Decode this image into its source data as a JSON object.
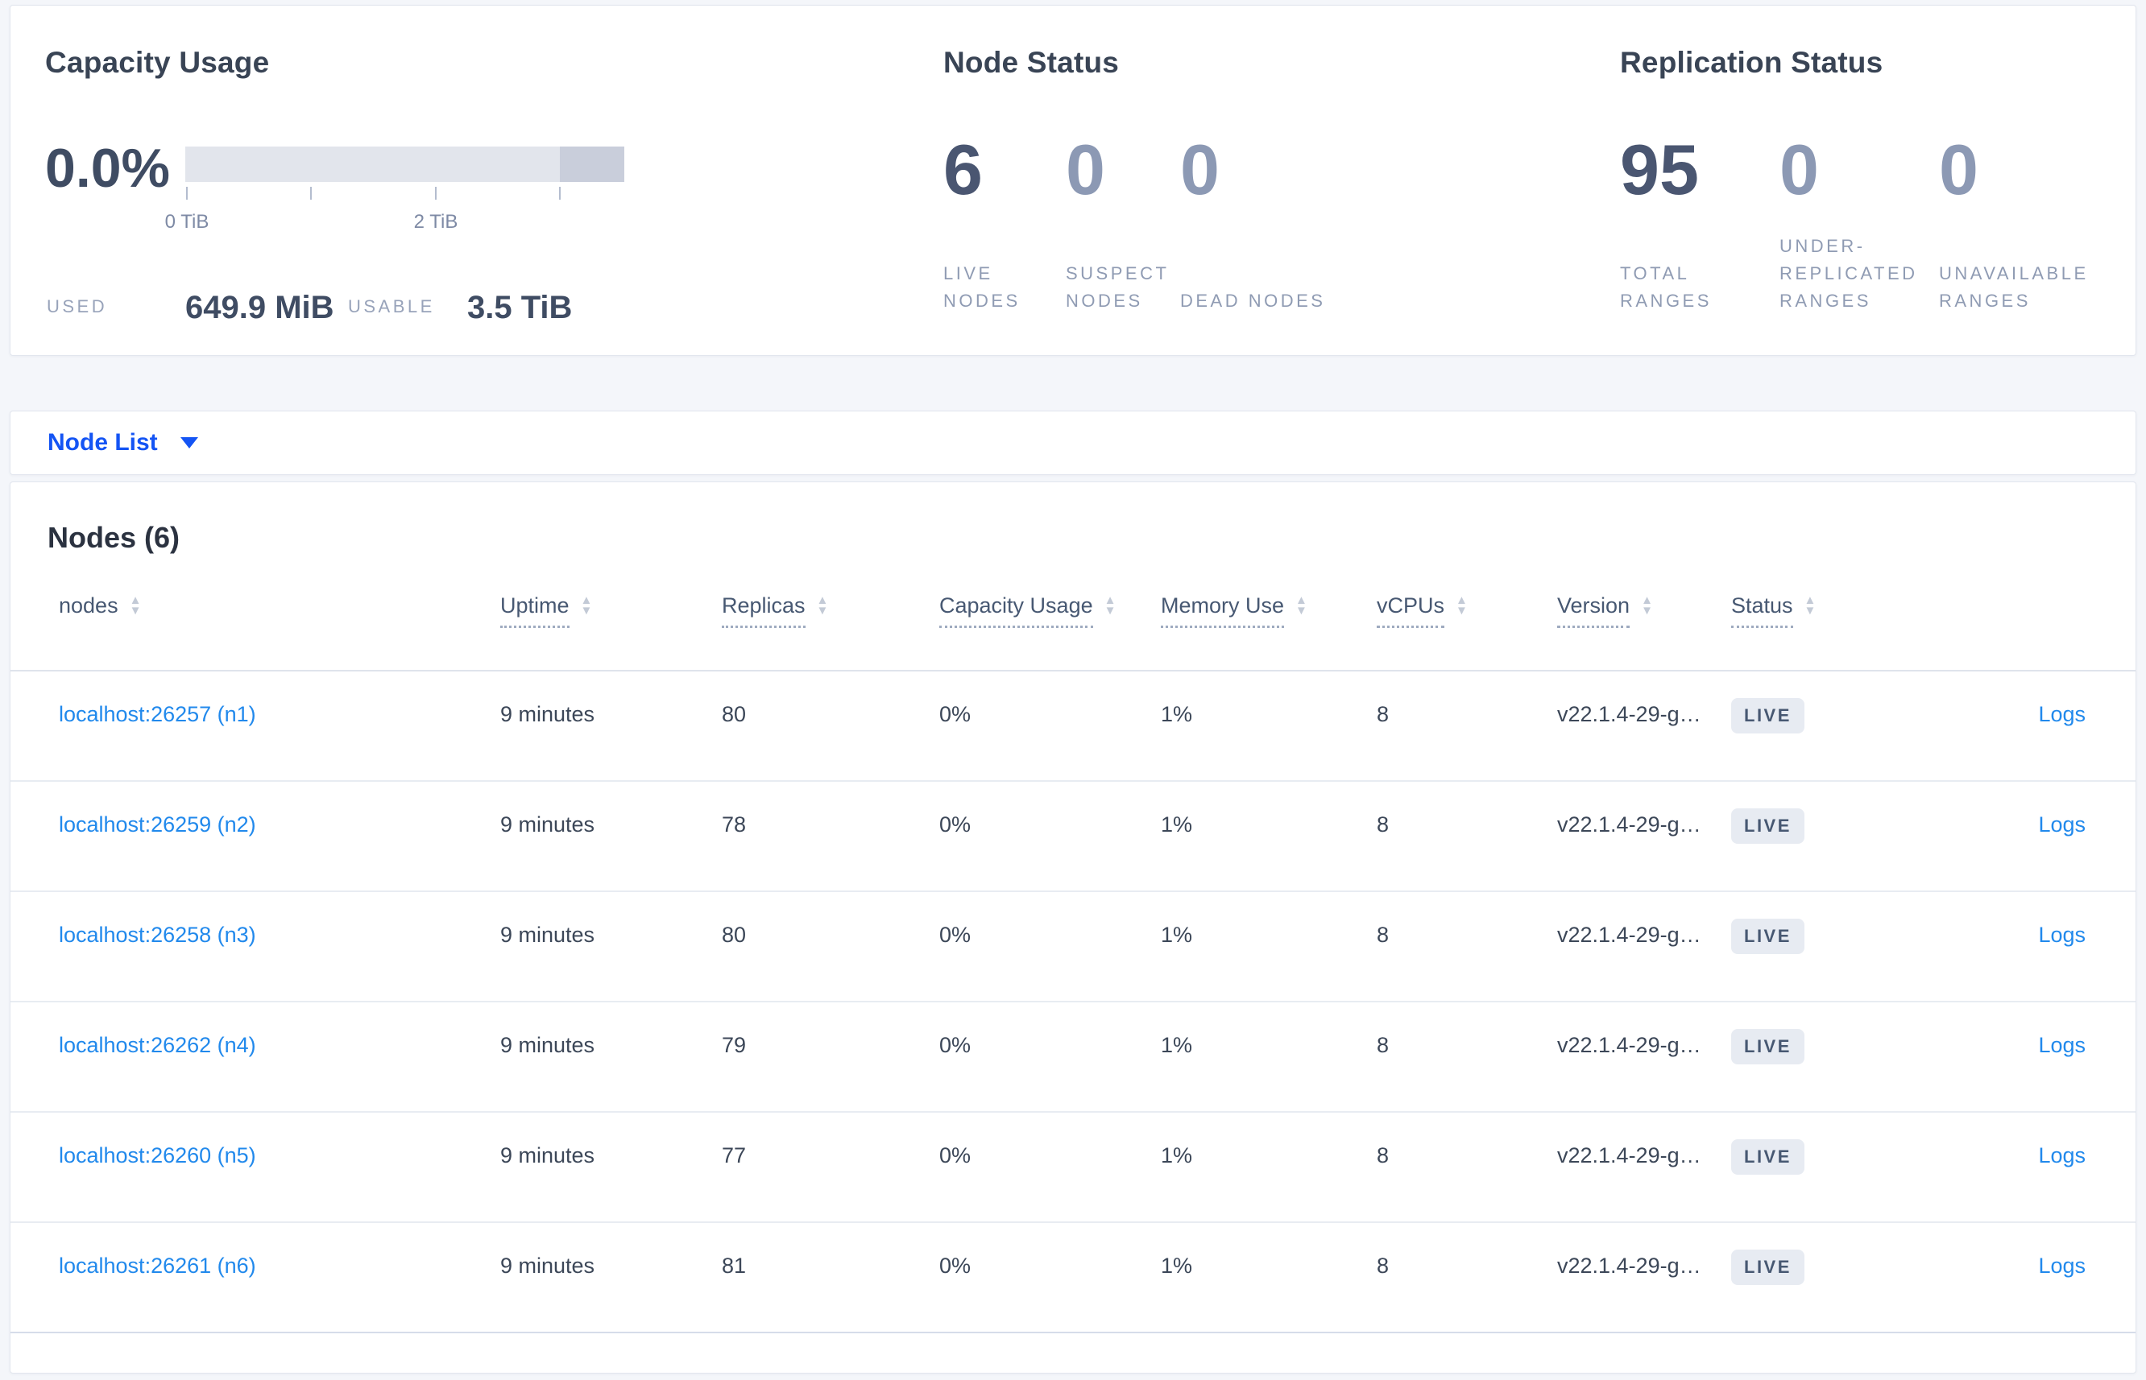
{
  "colors": {
    "page_background": "#f4f6fa",
    "panel_background": "#ffffff",
    "accent_blue": "#1454f4",
    "link_blue": "#2189ec",
    "dark_text": "#394455",
    "muted_text": "#8f9bb3",
    "bar_light": "#e2e5ec",
    "bar_dark": "#c9cedb",
    "badge_background": "#e7ebf2"
  },
  "capacity_panel": {
    "title": "Capacity Usage",
    "percent": "0.0%",
    "tick_labels": [
      "0 TiB",
      "2 TiB"
    ],
    "used_label": "USED",
    "used_value": "649.9 MiB",
    "usable_label": "USABLE",
    "usable_value": "3.5 TiB"
  },
  "node_status_panel": {
    "title": "Node Status",
    "stats": [
      {
        "value": "6",
        "label": "LIVE NODES",
        "emphasis": true
      },
      {
        "value": "0",
        "label": "SUSPECT NODES",
        "emphasis": false
      },
      {
        "value": "0",
        "label": "DEAD NODES",
        "emphasis": false
      }
    ]
  },
  "replication_panel": {
    "title": "Replication Status",
    "stats": [
      {
        "value": "95",
        "label": "TOTAL RANGES",
        "emphasis": true
      },
      {
        "value": "0",
        "label": "UNDER-REPLICATED RANGES",
        "emphasis": false
      },
      {
        "value": "0",
        "label": "UNAVAILABLE RANGES",
        "emphasis": false
      }
    ]
  },
  "view_selector": {
    "label": "Node List"
  },
  "nodes_table": {
    "title": "Nodes (6)",
    "columns": [
      {
        "label": "nodes",
        "underline": false
      },
      {
        "label": "Uptime",
        "underline": true
      },
      {
        "label": "Replicas",
        "underline": true
      },
      {
        "label": "Capacity Usage",
        "underline": true
      },
      {
        "label": "Memory Use",
        "underline": true
      },
      {
        "label": "vCPUs",
        "underline": true
      },
      {
        "label": "Version",
        "underline": true
      },
      {
        "label": "Status",
        "underline": true
      }
    ],
    "rows": [
      {
        "node": "localhost:26257 (n1)",
        "uptime": "9 minutes",
        "replicas": "80",
        "capacity_usage": "0%",
        "memory_use": "1%",
        "vcpus": "8",
        "version": "v22.1.4-29-g…",
        "status": "LIVE",
        "logs": "Logs"
      },
      {
        "node": "localhost:26259 (n2)",
        "uptime": "9 minutes",
        "replicas": "78",
        "capacity_usage": "0%",
        "memory_use": "1%",
        "vcpus": "8",
        "version": "v22.1.4-29-g…",
        "status": "LIVE",
        "logs": "Logs"
      },
      {
        "node": "localhost:26258 (n3)",
        "uptime": "9 minutes",
        "replicas": "80",
        "capacity_usage": "0%",
        "memory_use": "1%",
        "vcpus": "8",
        "version": "v22.1.4-29-g…",
        "status": "LIVE",
        "logs": "Logs"
      },
      {
        "node": "localhost:26262 (n4)",
        "uptime": "9 minutes",
        "replicas": "79",
        "capacity_usage": "0%",
        "memory_use": "1%",
        "vcpus": "8",
        "version": "v22.1.4-29-g…",
        "status": "LIVE",
        "logs": "Logs"
      },
      {
        "node": "localhost:26260 (n5)",
        "uptime": "9 minutes",
        "replicas": "77",
        "capacity_usage": "0%",
        "memory_use": "1%",
        "vcpus": "8",
        "version": "v22.1.4-29-g…",
        "status": "LIVE",
        "logs": "Logs"
      },
      {
        "node": "localhost:26261 (n6)",
        "uptime": "9 minutes",
        "replicas": "81",
        "capacity_usage": "0%",
        "memory_use": "1%",
        "vcpus": "8",
        "version": "v22.1.4-29-g…",
        "status": "LIVE",
        "logs": "Logs"
      }
    ]
  }
}
